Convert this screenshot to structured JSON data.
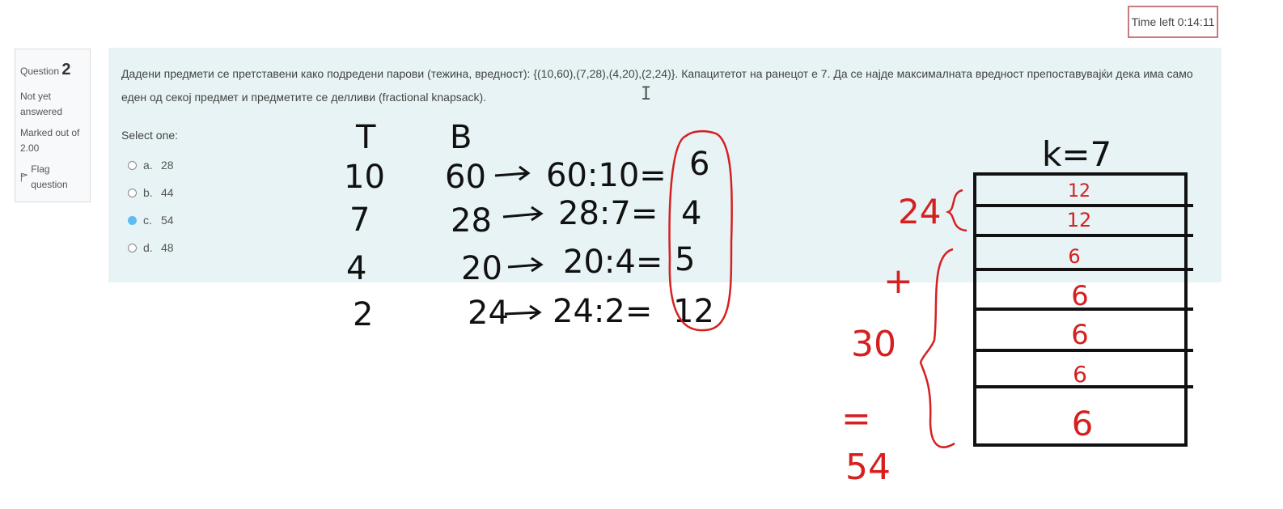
{
  "timer": {
    "label": "Time left 0:14:11"
  },
  "question_info": {
    "question_word": "Question",
    "number": "2",
    "state": "Not yet answered",
    "marks": "Marked out of 2.00",
    "flag_label": "Flag question"
  },
  "question": {
    "text": "Дадени предмети се претставени како подредени парови (тежина, вредност): {(10,60),(7,28),(4,20),(2,24)}. Капацитетот на ранецот е 7. Да се најде максималната вредност препоставувајќи дека има само еден од секој предмет и предметите се делливи (fractional knapsack).",
    "select_label": "Select one:",
    "options": [
      {
        "letter": "a.",
        "value": "28",
        "selected": false
      },
      {
        "letter": "b.",
        "value": "44",
        "selected": false
      },
      {
        "letter": "c.",
        "value": "54",
        "selected": true
      },
      {
        "letter": "d.",
        "value": "48",
        "selected": false
      }
    ]
  },
  "annotations": {
    "col_headers": [
      "T",
      "B"
    ],
    "rows": [
      {
        "weight": "10",
        "value": "60",
        "ratio": "60:10=",
        "result": "6"
      },
      {
        "weight": "7",
        "value": "28",
        "ratio": "28:7=",
        "result": "4"
      },
      {
        "weight": "4",
        "value": "20",
        "ratio": "20:4=",
        "result": "5"
      },
      {
        "weight": "2",
        "value": "24",
        "ratio": "24:2=",
        "result": "12"
      }
    ],
    "capacity_label": "k=7",
    "knapsack_cells": [
      "12",
      "12",
      "6",
      "6",
      "6",
      "6",
      "6"
    ],
    "side_notes": [
      "24",
      "+",
      "30",
      "=",
      "54"
    ],
    "colors": {
      "ink_black": "#111111",
      "ink_red": "#d62020"
    }
  }
}
